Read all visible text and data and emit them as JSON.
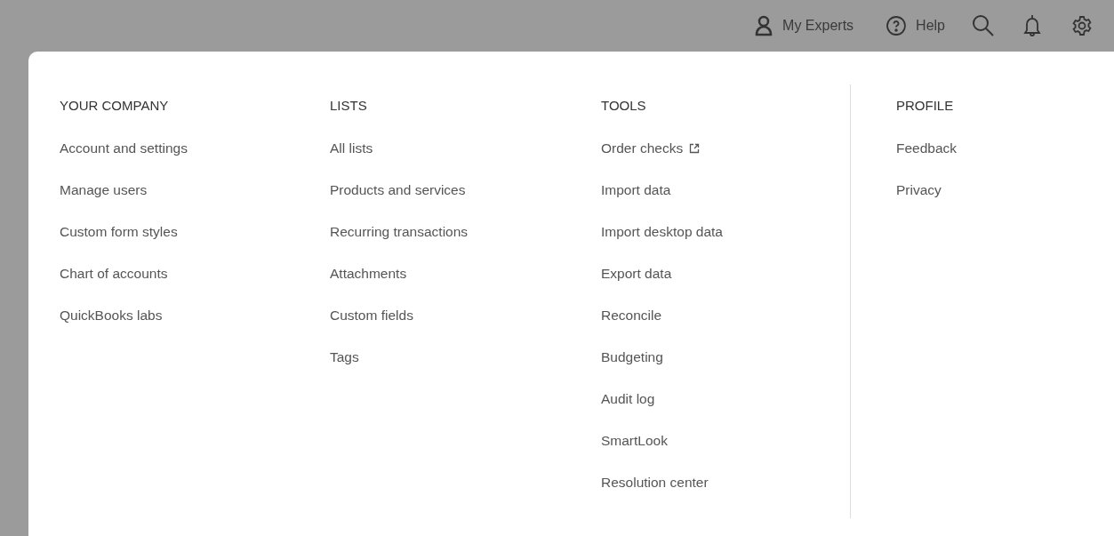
{
  "top_bar": {
    "experts": "My Experts",
    "help": "Help"
  },
  "menu": {
    "columns": [
      {
        "heading": "YOUR COMPANY",
        "items": [
          {
            "label": "Account and settings"
          },
          {
            "label": "Manage users"
          },
          {
            "label": "Custom form styles"
          },
          {
            "label": "Chart of accounts"
          },
          {
            "label": "QuickBooks labs"
          }
        ]
      },
      {
        "heading": "LISTS",
        "items": [
          {
            "label": "All lists"
          },
          {
            "label": "Products and services"
          },
          {
            "label": "Recurring transactions"
          },
          {
            "label": "Attachments"
          },
          {
            "label": "Custom fields"
          },
          {
            "label": "Tags"
          }
        ]
      },
      {
        "heading": "TOOLS",
        "items": [
          {
            "label": "Order checks",
            "kind": "external"
          },
          {
            "label": "Import data"
          },
          {
            "label": "Import desktop data"
          },
          {
            "label": "Export data"
          },
          {
            "label": "Reconcile"
          },
          {
            "label": "Budgeting"
          },
          {
            "label": "Audit log"
          },
          {
            "label": "SmartLook"
          },
          {
            "label": "Resolution center"
          }
        ]
      },
      {
        "heading": "PROFILE",
        "items": [
          {
            "label": "Feedback"
          },
          {
            "label": "Privacy"
          }
        ]
      }
    ]
  }
}
